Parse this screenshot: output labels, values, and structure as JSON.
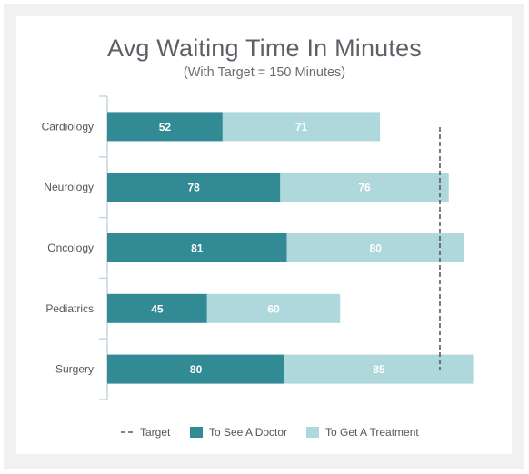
{
  "chart_data": {
    "type": "bar",
    "orientation": "horizontal",
    "stacked": true,
    "title": "Avg Waiting Time In Minutes",
    "subtitle": "(With Target = 150 Minutes)",
    "categories": [
      "Cardiology",
      "Neurology",
      "Oncology",
      "Pediatrics",
      "Surgery"
    ],
    "series": [
      {
        "name": "To See A Doctor",
        "color": "#328b94",
        "values": [
          52,
          78,
          81,
          45,
          80
        ]
      },
      {
        "name": "To Get A Treatment",
        "color": "#afd8dc",
        "values": [
          71,
          76,
          80,
          60,
          85
        ]
      }
    ],
    "target": {
      "name": "Target",
      "value": 150,
      "color": "#555555",
      "style": "dashed"
    },
    "xlabel": "",
    "ylabel": "",
    "xlim": [
      0,
      165
    ],
    "grid": false,
    "legend": "bottom",
    "legend_items": [
      "Target",
      "To See A Doctor",
      "To Get A Treatment"
    ]
  }
}
